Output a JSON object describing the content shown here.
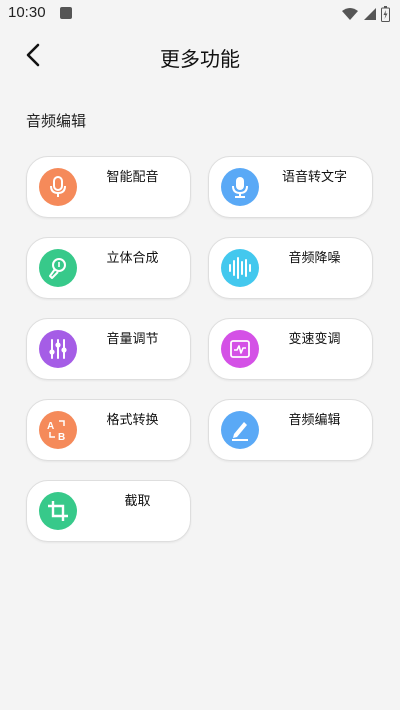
{
  "status": {
    "time": "10:30"
  },
  "header": {
    "title": "更多功能"
  },
  "section": {
    "title": "音频编辑"
  },
  "items": [
    {
      "label": "智能配音",
      "icon": "microphone-icon",
      "color": "#f58a5a"
    },
    {
      "label": "语音转文字",
      "icon": "microphone-icon",
      "color": "#5aa9f6"
    },
    {
      "label": "立体合成",
      "icon": "microphone-music-icon",
      "color": "#37c98a"
    },
    {
      "label": "音频降噪",
      "icon": "waveform-icon",
      "color": "#43c8ee"
    },
    {
      "label": "音量调节",
      "icon": "equalizer-sliders-icon",
      "color": "#a55de6"
    },
    {
      "label": "变速变调",
      "icon": "pulse-monitor-icon",
      "color": "#d451e6"
    },
    {
      "label": "格式转换",
      "icon": "format-convert-icon",
      "color": "#f58a5a"
    },
    {
      "label": "音频编辑",
      "icon": "pencil-icon",
      "color": "#5aa9f6"
    },
    {
      "label": "截取",
      "icon": "crop-icon",
      "color": "#37c98a"
    }
  ]
}
